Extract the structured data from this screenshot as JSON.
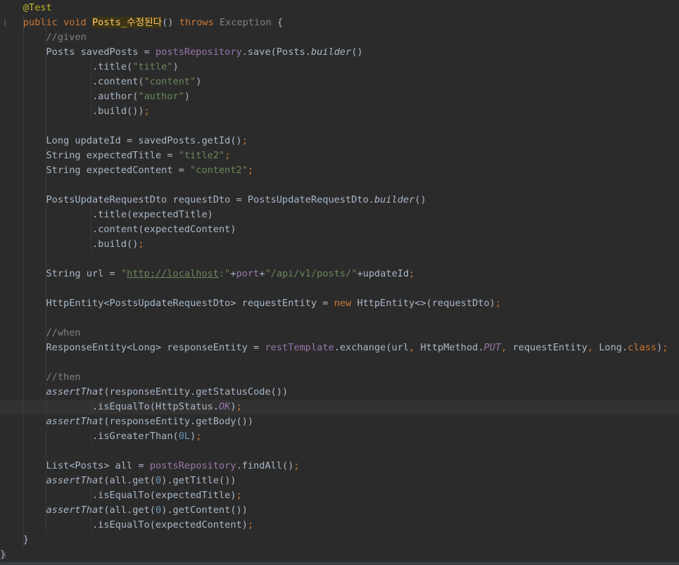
{
  "editor": {
    "language": "java",
    "theme_colors": {
      "background": "#2b2b2b",
      "default_text": "#a9b7c6",
      "keyword": "#cc7832",
      "annotation": "#bbb529",
      "comment": "#808080",
      "string": "#6a8759",
      "field": "#9876aa",
      "number": "#6897bb",
      "method_declaration": "#ffc66d"
    },
    "lines": [
      [
        {
          "t": "    "
        },
        {
          "t": "@Test",
          "c": "ann"
        }
      ],
      [
        {
          "t": "    "
        },
        {
          "t": "public void ",
          "c": "kw"
        },
        {
          "t": "Posts_수정된다",
          "c": "meth-hl"
        },
        {
          "t": "() "
        },
        {
          "t": "throws ",
          "c": "kw"
        },
        {
          "t": "Exception",
          "c": "exc"
        },
        {
          "t": " {"
        }
      ],
      [
        {
          "t": "        "
        },
        {
          "t": "//given",
          "c": "cm"
        }
      ],
      [
        {
          "t": "        Posts savedPosts = "
        },
        {
          "t": "postsRepository",
          "c": "fld"
        },
        {
          "t": ".save(Posts."
        },
        {
          "t": "builder",
          "c": "ita"
        },
        {
          "t": "()"
        }
      ],
      [
        {
          "t": "                .title("
        },
        {
          "t": "\"title\"",
          "c": "str"
        },
        {
          "t": ")"
        }
      ],
      [
        {
          "t": "                .content("
        },
        {
          "t": "\"content\"",
          "c": "str"
        },
        {
          "t": ")"
        }
      ],
      [
        {
          "t": "                .author("
        },
        {
          "t": "\"author\"",
          "c": "str"
        },
        {
          "t": ")"
        }
      ],
      [
        {
          "t": "                .build())"
        },
        {
          "t": ";",
          "c": "kw"
        }
      ],
      [],
      [
        {
          "t": "        Long updateId = savedPosts.getId()"
        },
        {
          "t": ";",
          "c": "kw"
        }
      ],
      [
        {
          "t": "        String expectedTitle = "
        },
        {
          "t": "\"title2\"",
          "c": "str"
        },
        {
          "t": ";",
          "c": "kw"
        }
      ],
      [
        {
          "t": "        String expectedContent = "
        },
        {
          "t": "\"content2\"",
          "c": "str"
        },
        {
          "t": ";",
          "c": "kw"
        }
      ],
      [],
      [
        {
          "t": "        PostsUpdateRequestDto requestDto = PostsUpdateRequestDto."
        },
        {
          "t": "builder",
          "c": "ita"
        },
        {
          "t": "()"
        }
      ],
      [
        {
          "t": "                .title(expectedTitle)"
        }
      ],
      [
        {
          "t": "                .content(expectedContent)"
        }
      ],
      [
        {
          "t": "                .build()"
        },
        {
          "t": ";",
          "c": "kw"
        }
      ],
      [],
      [
        {
          "t": "        String url = "
        },
        {
          "t": "\"",
          "c": "str"
        },
        {
          "t": "http://localhost",
          "c": "url-str"
        },
        {
          "t": ":\"",
          "c": "str"
        },
        {
          "t": "+"
        },
        {
          "t": "port",
          "c": "fld"
        },
        {
          "t": "+"
        },
        {
          "t": "\"/api/v1/posts/\"",
          "c": "str"
        },
        {
          "t": "+updateId"
        },
        {
          "t": ";",
          "c": "kw"
        }
      ],
      [],
      [
        {
          "t": "        HttpEntity<PostsUpdateRequestDto> requestEntity = "
        },
        {
          "t": "new ",
          "c": "kw"
        },
        {
          "t": "HttpEntity<>(requestDto)"
        },
        {
          "t": ";",
          "c": "kw"
        }
      ],
      [],
      [
        {
          "t": "        "
        },
        {
          "t": "//when",
          "c": "cm"
        }
      ],
      [
        {
          "t": "        ResponseEntity<Long> responseEntity = "
        },
        {
          "t": "restTemplate",
          "c": "fld"
        },
        {
          "t": ".exchange(url"
        },
        {
          "t": ", ",
          "c": "kw"
        },
        {
          "t": "HttpMethod."
        },
        {
          "t": "PUT",
          "c": "static"
        },
        {
          "t": ", ",
          "c": "kw"
        },
        {
          "t": "requestEntity"
        },
        {
          "t": ", ",
          "c": "kw"
        },
        {
          "t": "Long."
        },
        {
          "t": "class",
          "c": "kw"
        },
        {
          "t": ")"
        },
        {
          "t": ";",
          "c": "kw"
        }
      ],
      [],
      [
        {
          "t": "        "
        },
        {
          "t": "//then",
          "c": "cm"
        }
      ],
      [
        {
          "t": "        "
        },
        {
          "t": "assertThat",
          "c": "ita"
        },
        {
          "t": "(responseEntity.getStatusCode())"
        }
      ],
      [
        {
          "t": "                .isEqualTo(HttpStatus."
        },
        {
          "t": "OK",
          "c": "static"
        },
        {
          "t": ")"
        },
        {
          "t": ";",
          "c": "kw"
        }
      ],
      [
        {
          "t": "        "
        },
        {
          "t": "assertThat",
          "c": "ita"
        },
        {
          "t": "(responseEntity.getBody())"
        }
      ],
      [
        {
          "t": "                .isGreaterThan("
        },
        {
          "t": "0L",
          "c": "num"
        },
        {
          "t": ")"
        },
        {
          "t": ";",
          "c": "kw"
        }
      ],
      [],
      [
        {
          "t": "        List<Posts> all = "
        },
        {
          "t": "postsRepository",
          "c": "fld"
        },
        {
          "t": ".findAll()"
        },
        {
          "t": ";",
          "c": "kw"
        }
      ],
      [
        {
          "t": "        "
        },
        {
          "t": "assertThat",
          "c": "ita"
        },
        {
          "t": "(all.get("
        },
        {
          "t": "0",
          "c": "num"
        },
        {
          "t": ").getTitle())"
        }
      ],
      [
        {
          "t": "                .isEqualTo(expectedTitle)"
        },
        {
          "t": ";",
          "c": "kw"
        }
      ],
      [
        {
          "t": "        "
        },
        {
          "t": "assertThat",
          "c": "ita"
        },
        {
          "t": "(all.get("
        },
        {
          "t": "0",
          "c": "num"
        },
        {
          "t": ").getContent())"
        }
      ],
      [
        {
          "t": "                .isEqualTo(expectedContent)"
        },
        {
          "t": ";",
          "c": "kw"
        }
      ],
      [
        {
          "t": "    }"
        }
      ],
      [
        {
          "t": "}"
        }
      ]
    ],
    "current_line_index": 27
  }
}
